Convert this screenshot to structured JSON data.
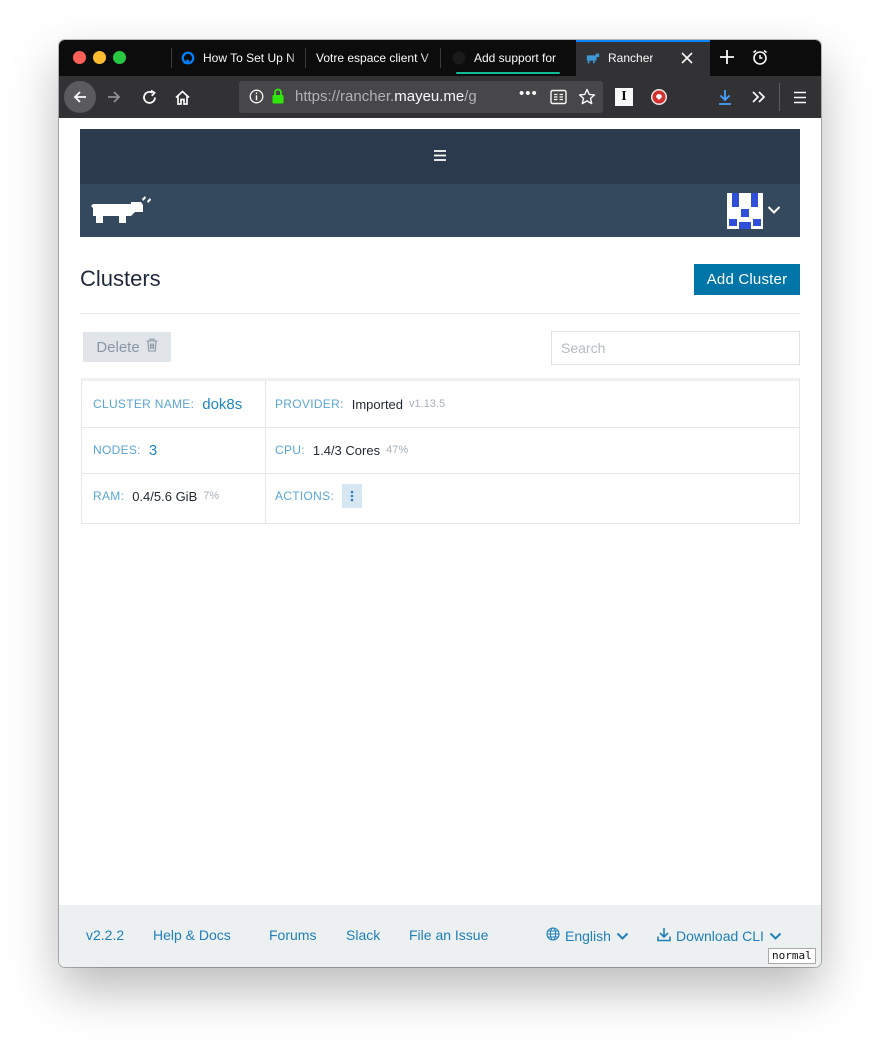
{
  "browser": {
    "tabs": [
      {
        "label": "How To Set Up N",
        "favicon": "digitalocean-icon"
      },
      {
        "label": "Votre espace client V",
        "favicon": "none"
      },
      {
        "label": "Add support for",
        "favicon": "github-icon"
      },
      {
        "label": "Rancher",
        "favicon": "rancher-icon"
      }
    ],
    "url": {
      "prefix": "https://rancher.",
      "domain": "mayeu.me",
      "suffix": "/g"
    }
  },
  "app": {
    "page_title": "Clusters",
    "add_cluster_label": "Add Cluster",
    "delete_label": "Delete",
    "search_placeholder": "Search",
    "cluster": {
      "name_label": "CLUSTER NAME:",
      "name_value": "dok8s",
      "provider_label": "PROVIDER:",
      "provider_value": "Imported",
      "provider_version": "v1.13.5",
      "nodes_label": "NODES:",
      "nodes_value": "3",
      "cpu_label": "CPU:",
      "cpu_value": "1.4/3 Cores",
      "cpu_percent": "47%",
      "ram_label": "RAM:",
      "ram_value": "0.4/5.6 GiB",
      "ram_percent": "7%",
      "actions_label": "ACTIONS:"
    },
    "footer": {
      "version": "v2.2.2",
      "help": "Help & Docs",
      "forums": "Forums",
      "slack": "Slack",
      "issue": "File an Issue",
      "language": "English",
      "download": "Download CLI"
    },
    "mode_tag": "normal"
  },
  "colors": {
    "nav_dark": "#2b3a4d",
    "nav_brand": "#34495e",
    "accent": "#0075a8",
    "link": "#1f7fb8"
  }
}
